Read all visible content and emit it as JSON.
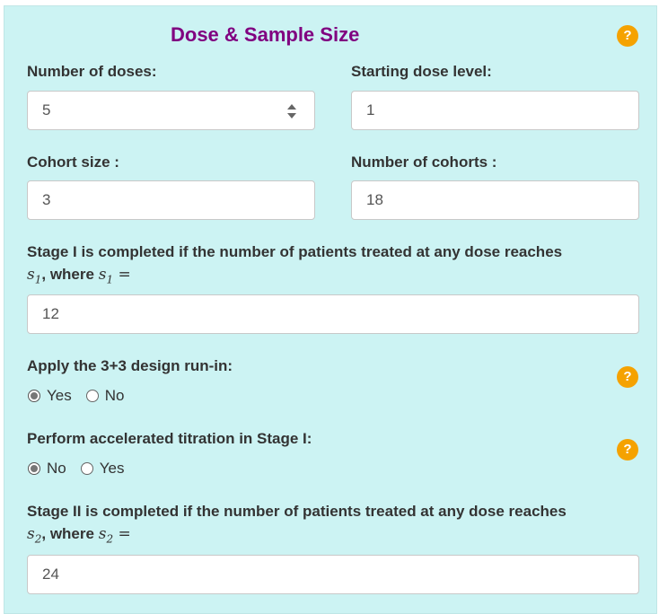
{
  "header": {
    "title": "Dose & Sample Size",
    "help_glyph": "?"
  },
  "doses": {
    "label": "Number of doses:",
    "value": "5"
  },
  "start_dose": {
    "label": "Starting dose level:",
    "value": "1"
  },
  "cohort_size": {
    "label": "Cohort size :",
    "value": "3"
  },
  "num_cohorts": {
    "label": "Number of cohorts :",
    "value": "18"
  },
  "stage1": {
    "label": "Stage I is completed if the number of patients treated at any dose reaches",
    "var": "s",
    "sub": "1",
    "where": ", where",
    "eq": " =",
    "value": "12"
  },
  "runin": {
    "label": "Apply the 3+3 design run-in:",
    "options": [
      "Yes",
      "No"
    ],
    "selected": "Yes"
  },
  "titration": {
    "label": "Perform accelerated titration in Stage I:",
    "options": [
      "No",
      "Yes"
    ],
    "selected": "No"
  },
  "stage2": {
    "label": "Stage II is completed if the number of patients treated at any dose reaches",
    "var": "s",
    "sub": "2",
    "where": ", where",
    "eq": " =",
    "value": "24"
  },
  "colors": {
    "panel": "#ccf3f3",
    "title": "#800080",
    "help": "#f5a200"
  }
}
